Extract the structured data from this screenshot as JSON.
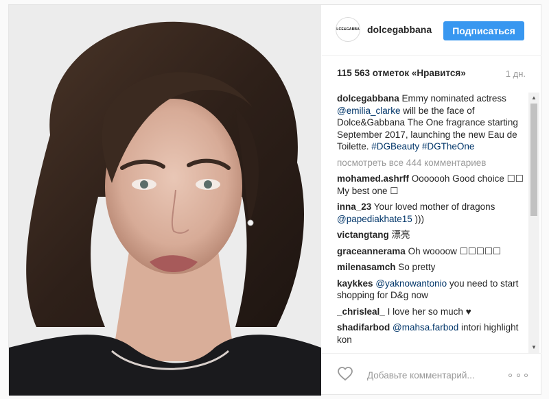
{
  "post": {
    "image_alt": "Portrait of a woman with wavy shoulder-length brown hair"
  },
  "header": {
    "avatar_text": "DOLCE&GABBANA",
    "username": "dolcegabbana",
    "follow_label": "Подписаться"
  },
  "stats": {
    "likes": "115 563 отметок «Нравится»",
    "age": "1 дн."
  },
  "caption": {
    "user": "dolcegabbana",
    "text1": " Emmy nominated actress ",
    "mention": "@emilia_clarke",
    "text2": " will be the face of Dolce&Gabbana The One fragrance starting September 2017, launching the new Eau de Toilette. ",
    "tag1": "#DGBeauty",
    "tag2": "#DGTheOne"
  },
  "view_all": "посмотреть все 444 комментариев",
  "comments": [
    {
      "user": "mohamed.ashrff",
      "text": " Ooooooh Good choice ☐☐ My best one ☐"
    },
    {
      "user": "inna_23",
      "text": " Your loved mother of dragons ",
      "mention": "@papediakhate15",
      "text2": " )))"
    },
    {
      "user": "victangtang",
      "text": " 漂亮"
    },
    {
      "user": "graceannerama",
      "text": " Oh woooow ☐☐☐☐☐"
    },
    {
      "user": "milenasamch",
      "text": " So pretty"
    },
    {
      "user": "kaykkes",
      "text": " ",
      "mention": "@yaknowantonio",
      "text2": " you need to start shopping for D&g now"
    },
    {
      "user": "_chrisleal_",
      "text": " I love her so much ♥"
    },
    {
      "user": "shadifarbod",
      "text": " ",
      "mention": "@mahsa.farbod",
      "text2": " intori highlight kon"
    }
  ],
  "footer": {
    "comment_placeholder": "Добавьте комментарий..."
  }
}
